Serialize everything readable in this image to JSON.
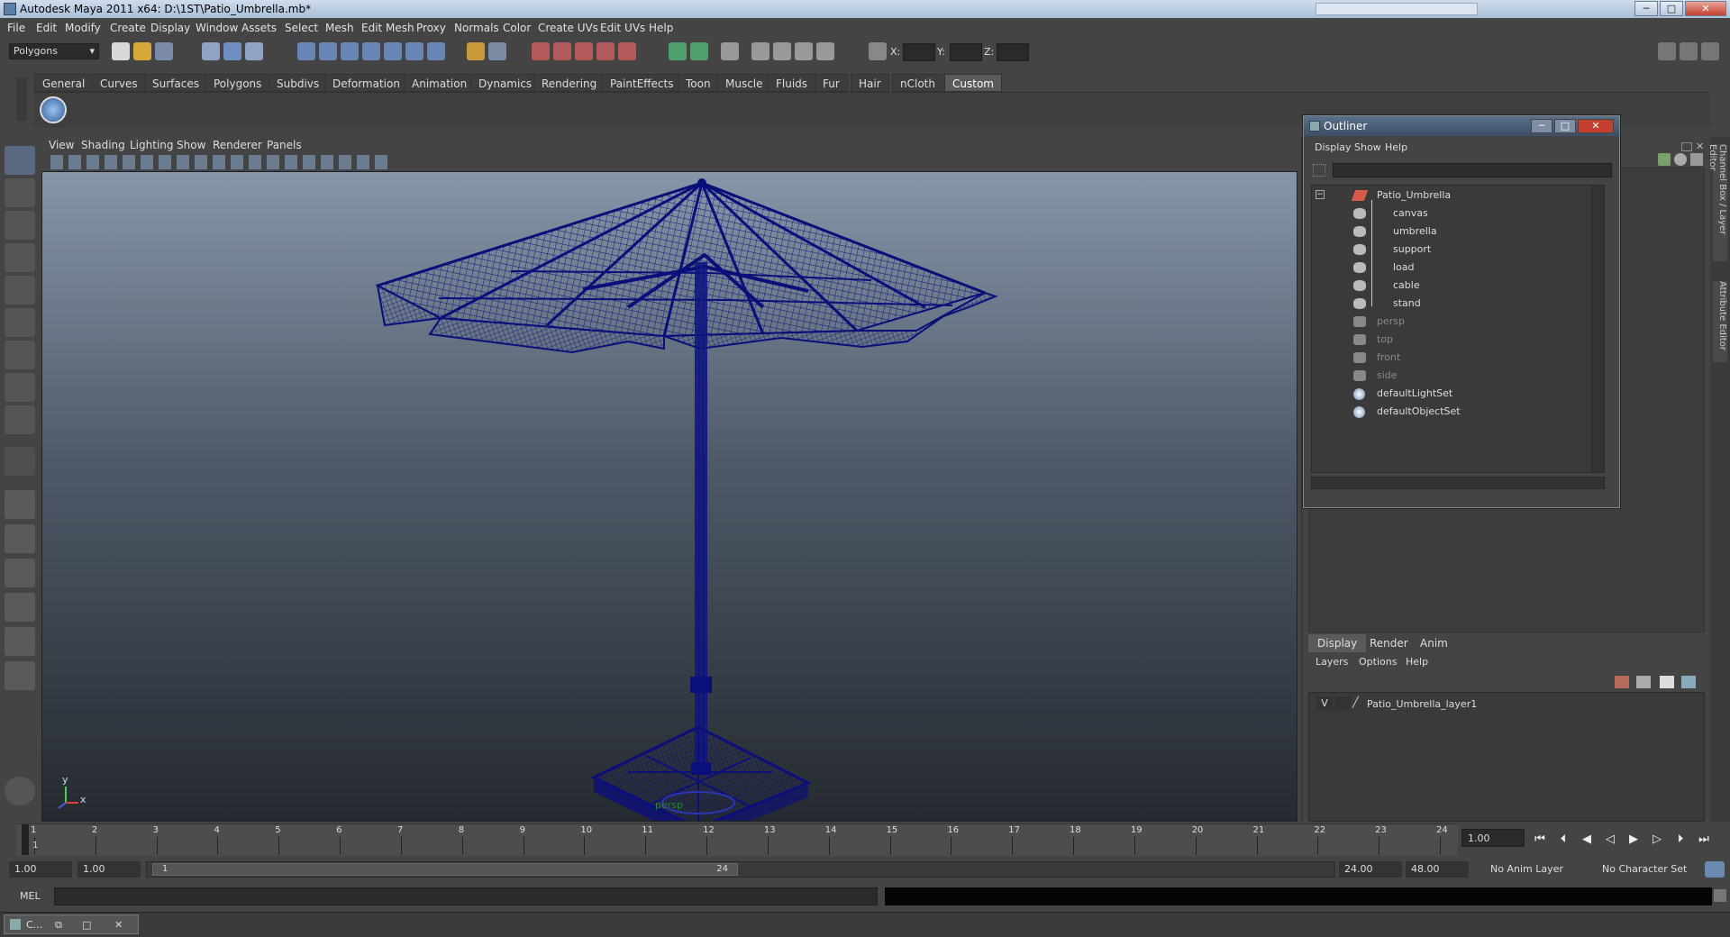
{
  "window": {
    "title": "Autodesk Maya 2011 x64: D:\\1ST\\Patio_Umbrella.mb*",
    "buttons": [
      "─",
      "□",
      "✕"
    ]
  },
  "menubar": [
    "File",
    "Edit",
    "Modify",
    "Create",
    "Display",
    "Window",
    "Assets",
    "Select",
    "Mesh",
    "Edit Mesh",
    "Proxy",
    "Normals",
    "Color",
    "Create UVs",
    "Edit UVs",
    "Help"
  ],
  "status_line": {
    "mode": "Polygons",
    "x_label": "X:",
    "y_label": "Y:",
    "z_label": "Z:"
  },
  "shelf_tabs": [
    "General",
    "Curves",
    "Surfaces",
    "Polygons",
    "Subdivs",
    "Deformation",
    "Animation",
    "Dynamics",
    "Rendering",
    "PaintEffects",
    "Toon",
    "Muscle",
    "Fluids",
    "Fur",
    "Hair",
    "nCloth",
    "Custom"
  ],
  "shelf_active": "Custom",
  "panel_menu": [
    "View",
    "Shading",
    "Lighting",
    "Show",
    "Renderer",
    "Panels"
  ],
  "viewport": {
    "camera_label": "persp",
    "axis_y": "y",
    "axis_x": "x",
    "wire_color": "#0b0f7a"
  },
  "outliner": {
    "title": "Outliner",
    "menu": [
      "Display",
      "Show",
      "Help"
    ],
    "items": [
      {
        "label": "Patio_Umbrella",
        "icon": "transform-icon",
        "dim": false
      },
      {
        "label": "canvas",
        "icon": "mesh-icon",
        "dim": false
      },
      {
        "label": "umbrella",
        "icon": "mesh-icon",
        "dim": false
      },
      {
        "label": "support",
        "icon": "mesh-icon",
        "dim": false
      },
      {
        "label": "load",
        "icon": "mesh-icon",
        "dim": false
      },
      {
        "label": "cable",
        "icon": "mesh-icon",
        "dim": false
      },
      {
        "label": "stand",
        "icon": "mesh-icon",
        "dim": false
      },
      {
        "label": "persp",
        "icon": "camera-icon",
        "dim": true
      },
      {
        "label": "top",
        "icon": "camera-icon",
        "dim": true
      },
      {
        "label": "front",
        "icon": "camera-icon",
        "dim": true
      },
      {
        "label": "side",
        "icon": "camera-icon",
        "dim": true
      },
      {
        "label": "defaultLightSet",
        "icon": "set-icon",
        "dim": false
      },
      {
        "label": "defaultObjectSet",
        "icon": "set-icon",
        "dim": false
      }
    ]
  },
  "layer_editor": {
    "tabs": [
      "Display",
      "Render",
      "Anim"
    ],
    "active_tab": "Display",
    "menu": [
      "Layers",
      "Options",
      "Help"
    ],
    "layer": {
      "visible": "V",
      "name": "Patio_Umbrella_layer1"
    }
  },
  "side_tabs": [
    "Channel Box / Layer Editor",
    "Attribute Editor"
  ],
  "timeline": {
    "ticks": [
      "1",
      "2",
      "3",
      "4",
      "5",
      "6",
      "7",
      "8",
      "9",
      "10",
      "11",
      "12",
      "13",
      "14",
      "15",
      "16",
      "17",
      "18",
      "19",
      "20",
      "21",
      "22",
      "23",
      "24"
    ],
    "current_frame": "1",
    "current_time_field": "1.00"
  },
  "range": {
    "start_time": "1.00",
    "playback_start": "1.00",
    "slider_start": "1",
    "slider_end": "24",
    "playback_end": "24.00",
    "end_time": "48.00",
    "anim_layer": "No Anim Layer",
    "character_set": "No Character Set"
  },
  "command_line": {
    "label": "MEL"
  },
  "taskbar": {
    "item": "C..."
  }
}
